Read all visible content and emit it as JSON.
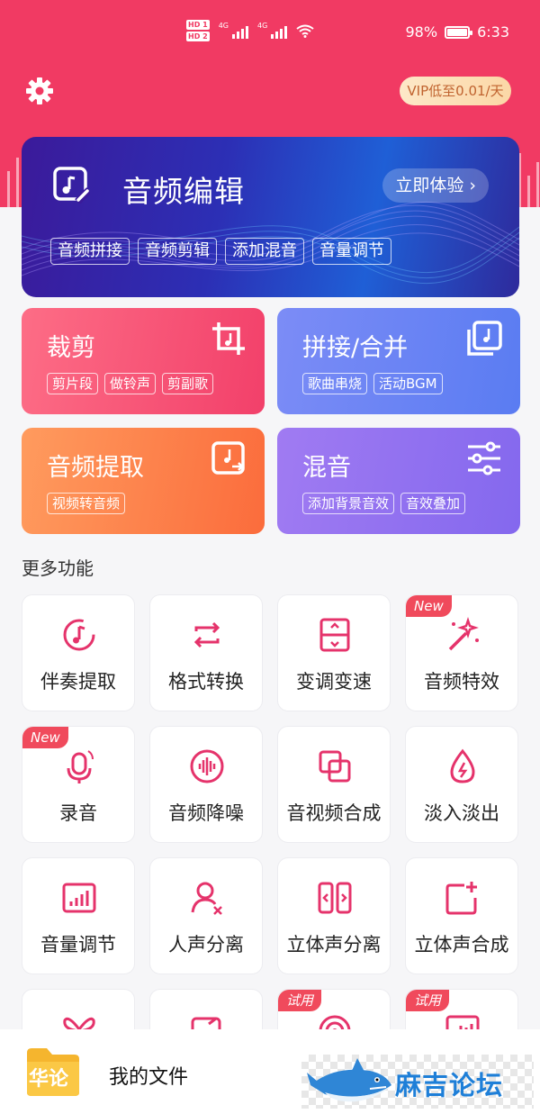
{
  "status_bar": {
    "hd1": "HD 1",
    "hd2": "HD 2",
    "net1": "4G",
    "net2": "4G",
    "battery": "98%",
    "battery_level": 0.98,
    "time": "6:33"
  },
  "header": {
    "settings_icon": "gear-icon",
    "vip_label": "VIP低至0.01/天",
    "accent_color": "#f13a63"
  },
  "hero": {
    "title": "音频编辑",
    "cta": "立即体验",
    "cta_icon": "chevron-right-icon",
    "tags": [
      "音频拼接",
      "音频剪辑",
      "添加混音",
      "音量调节"
    ]
  },
  "features": [
    {
      "title": "裁剪",
      "icon": "crop-music-icon",
      "tags": [
        "剪片段",
        "做铃声",
        "剪副歌"
      ]
    },
    {
      "title": "拼接/合并",
      "icon": "merge-music-icon",
      "tags": [
        "歌曲串烧",
        "活动BGM"
      ]
    },
    {
      "title": "音频提取",
      "icon": "extract-audio-icon",
      "tags": [
        "视频转音频"
      ]
    },
    {
      "title": "混音",
      "icon": "sliders-icon",
      "tags": [
        "添加背景音效",
        "音效叠加"
      ]
    }
  ],
  "more": {
    "title": "更多功能",
    "tiles": [
      {
        "label": "伴奏提取",
        "icon": "accompaniment-icon",
        "badge": ""
      },
      {
        "label": "格式转换",
        "icon": "convert-icon",
        "badge": ""
      },
      {
        "label": "变调变速",
        "icon": "pitch-speed-icon",
        "badge": ""
      },
      {
        "label": "音频特效",
        "icon": "magic-wand-icon",
        "badge": "New"
      },
      {
        "label": "录音",
        "icon": "microphone-icon",
        "badge": "New"
      },
      {
        "label": "音频降噪",
        "icon": "noise-reduction-icon",
        "badge": ""
      },
      {
        "label": "音视频合成",
        "icon": "compose-icon",
        "badge": ""
      },
      {
        "label": "淡入淡出",
        "icon": "fade-icon",
        "badge": ""
      },
      {
        "label": "音量调节",
        "icon": "volume-bars-icon",
        "badge": ""
      },
      {
        "label": "人声分离",
        "icon": "voice-separate-icon",
        "badge": ""
      },
      {
        "label": "立体声分离",
        "icon": "stereo-split-icon",
        "badge": ""
      },
      {
        "label": "立体声合成",
        "icon": "stereo-merge-icon",
        "badge": ""
      },
      {
        "label": "",
        "icon": "butterfly-icon",
        "badge": ""
      },
      {
        "label": "",
        "icon": "music-doc-icon",
        "badge": ""
      },
      {
        "label": "",
        "icon": "target-icon",
        "badge": "试用"
      },
      {
        "label": "",
        "icon": "chart-icon",
        "badge": "试用"
      }
    ]
  },
  "bottom": {
    "folder_icon": "folder-icon",
    "folder_overlay": "华论",
    "my_files": "我的文件",
    "watermark": "麻吉论坛"
  }
}
